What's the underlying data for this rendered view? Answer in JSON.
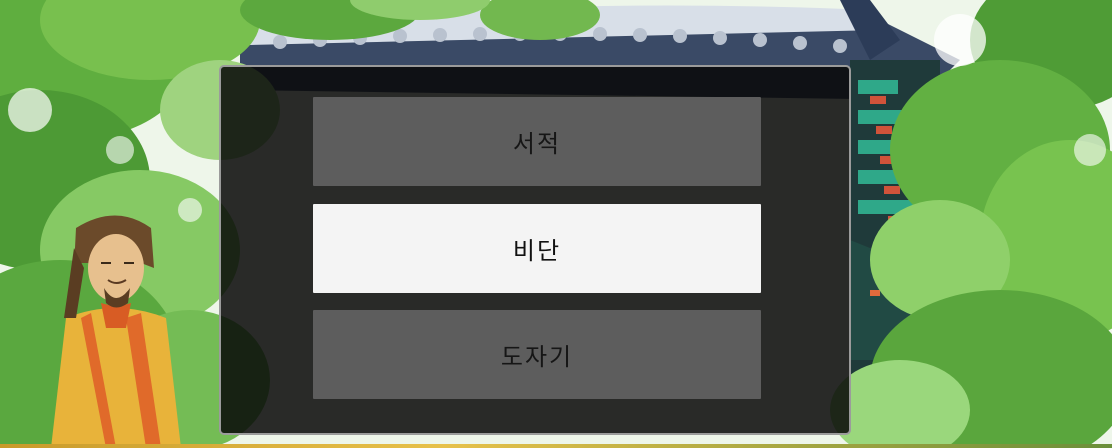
{
  "menu": {
    "items": [
      {
        "label": "서적",
        "selected": false
      },
      {
        "label": "비단",
        "selected": true
      },
      {
        "label": "도자기",
        "selected": false
      }
    ]
  },
  "colors": {
    "panel_bg": "#080808",
    "panel_border": "#9b9b9b",
    "button_bg": "#5d5d5d",
    "button_selected_bg": "#f4f4f4",
    "foliage": "#5fae3f"
  },
  "icons": {
    "character": "scholar-portrait",
    "background": "korean-pavilion-with-trees"
  }
}
